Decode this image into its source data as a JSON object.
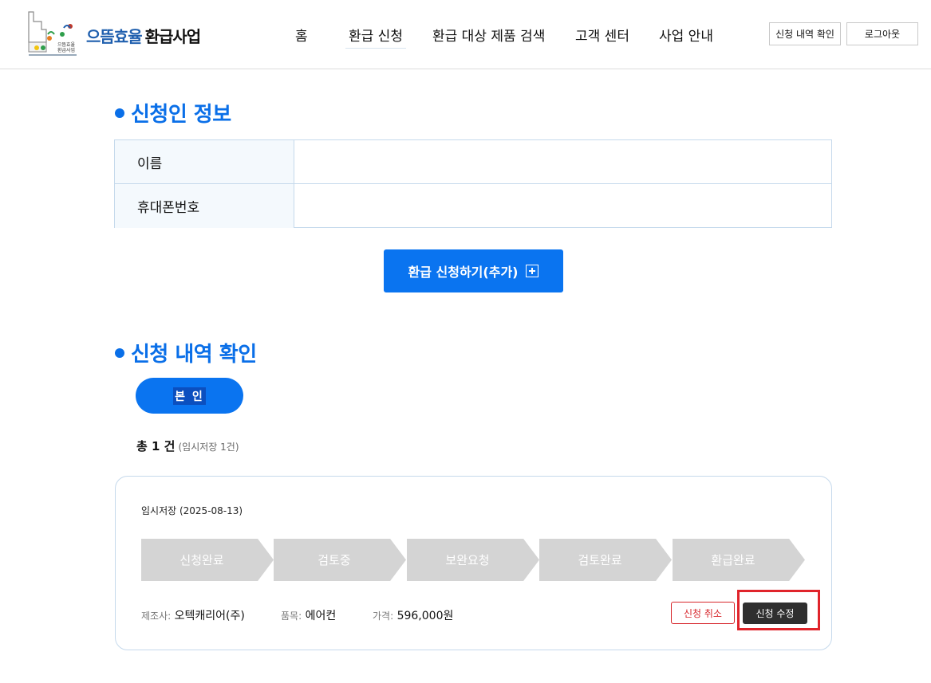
{
  "header": {
    "logo_icon": "energy-efficiency-logo",
    "logo_small_text": [
      "으뜸효율",
      "환급사업"
    ],
    "brand_part1": "으뜸효율",
    "brand_part2": "환급사업",
    "nav": [
      "홈",
      "환급 신청",
      "환급 대상 제품 검색",
      "고객 센터",
      "사업 안내"
    ],
    "active_nav": "환급 신청",
    "history_button": "신청 내역 확인",
    "logout_button": "로그아웃"
  },
  "applicant": {
    "title": "신청인 정보",
    "rows": [
      {
        "label": "이름",
        "value": ""
      },
      {
        "label": "휴대폰번호",
        "value": ""
      }
    ]
  },
  "apply_button": {
    "label": "환급 신청하기(추가)",
    "icon": "plus-square-icon"
  },
  "history": {
    "title": "신청 내역 확인",
    "tab_label": "본 인",
    "total_label": "총 1 건",
    "total_sub": "(임시저장 1건)",
    "card": {
      "status_date": "임시저장 (2025-08-13)",
      "steps": [
        "신청완료",
        "검토중",
        "보완요청",
        "검토완료",
        "환급완료"
      ],
      "manufacturer_label": "제조사:",
      "manufacturer": "오텍캐리어(주)",
      "product_label": "품목:",
      "product": "에어컨",
      "price_label": "가격:",
      "price": "596,000원",
      "cancel_button": "신청 취소",
      "edit_button": "신청 수정"
    }
  },
  "colors": {
    "accent": "#0a74f0",
    "title_blue": "#0a6fe8",
    "step_gray": "#d4d4d4",
    "cancel_red": "#d7262b",
    "highlight_red": "#e0242b"
  }
}
